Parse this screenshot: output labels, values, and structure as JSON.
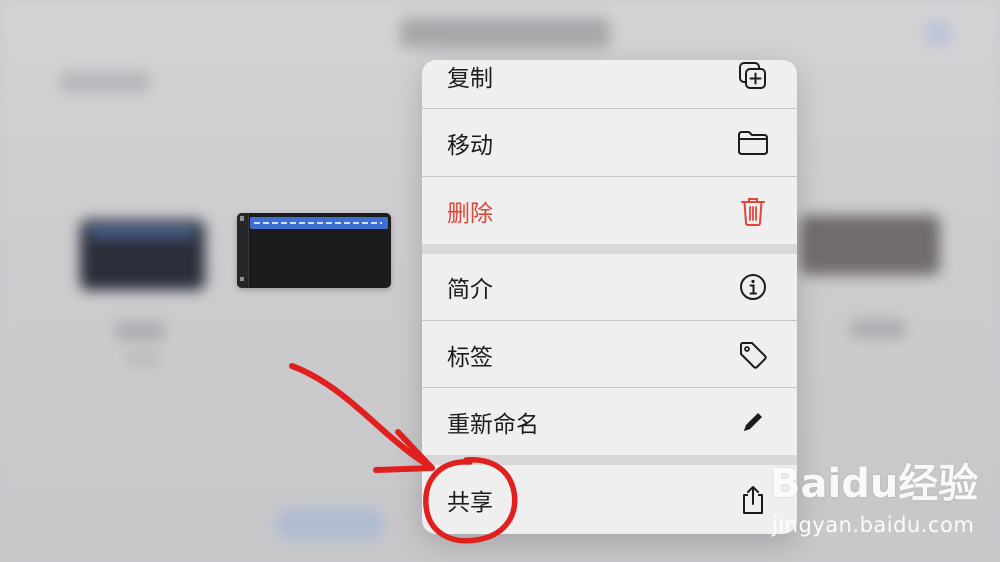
{
  "menu": {
    "items": [
      {
        "label": "复制",
        "icon": "duplicate-icon"
      },
      {
        "label": "移动",
        "icon": "folder-icon"
      },
      {
        "label": "删除",
        "icon": "trash-icon",
        "color": "#e0453a"
      },
      {
        "label": "简介",
        "icon": "info-icon"
      },
      {
        "label": "标签",
        "icon": "tag-icon"
      },
      {
        "label": "重新命名",
        "icon": "pencil-icon"
      },
      {
        "label": "共享",
        "icon": "share-icon"
      }
    ]
  },
  "annotation": {
    "color": "#e0201e"
  },
  "watermark": {
    "brand": "Baidu经验",
    "url": "jingyan.baidu.com"
  }
}
